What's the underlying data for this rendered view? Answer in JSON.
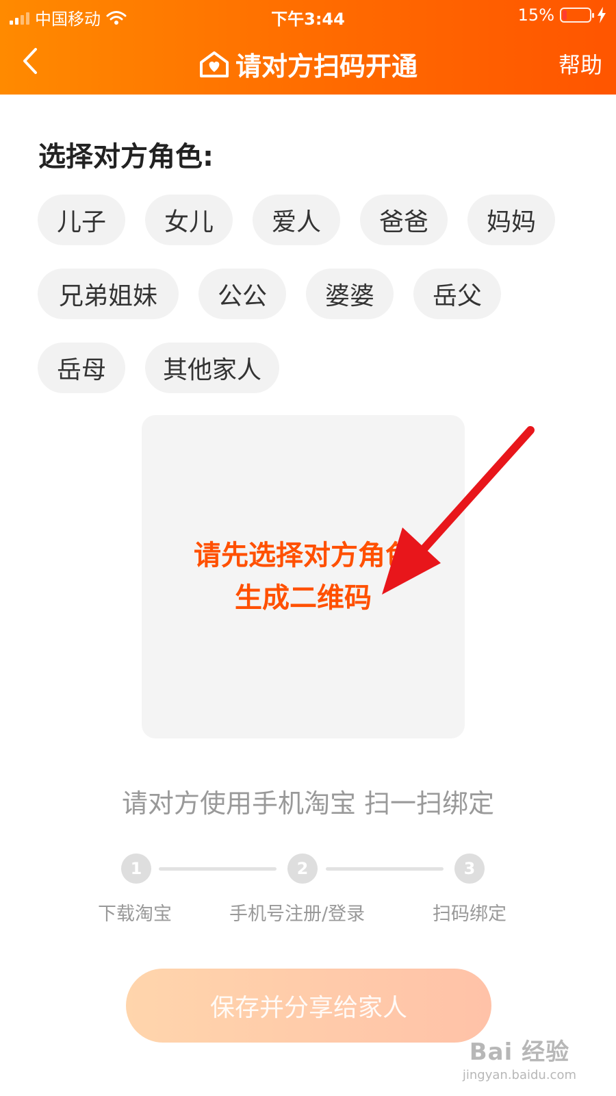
{
  "status_bar": {
    "carrier": "中国移动",
    "time": "下午3:44",
    "battery_percent": "15%",
    "battery_level": 0.15
  },
  "nav": {
    "title": "请对方扫码开通",
    "help_label": "帮助",
    "title_icon": "home-heart-icon",
    "back_icon": "chevron-left-icon"
  },
  "role_section": {
    "title": "选择对方角色:",
    "roles": [
      {
        "label": "儿子"
      },
      {
        "label": "女儿"
      },
      {
        "label": "爱人"
      },
      {
        "label": "爸爸"
      },
      {
        "label": "妈妈"
      },
      {
        "label": "兄弟姐妹"
      },
      {
        "label": "公公"
      },
      {
        "label": "婆婆"
      },
      {
        "label": "岳父"
      },
      {
        "label": "岳母"
      },
      {
        "label": "其他家人"
      }
    ]
  },
  "qr_placeholder": {
    "line1": "请先选择对方角色",
    "line2": "生成二维码"
  },
  "instruction": "请对方使用手机淘宝 扫一扫绑定",
  "steps": [
    {
      "number": "1",
      "label": "下载淘宝"
    },
    {
      "number": "2",
      "label": "手机号注册/登录"
    },
    {
      "number": "3",
      "label": "扫码绑定"
    }
  ],
  "save_share_label": "保存并分享给家人",
  "watermark": {
    "logo": "Bai 经验",
    "site": "jingyan.baidu.com"
  },
  "colors": {
    "header_start": "#ff8a00",
    "header_end": "#ff5500",
    "accent": "#ff5000",
    "annotation_arrow": "#e8161b"
  }
}
